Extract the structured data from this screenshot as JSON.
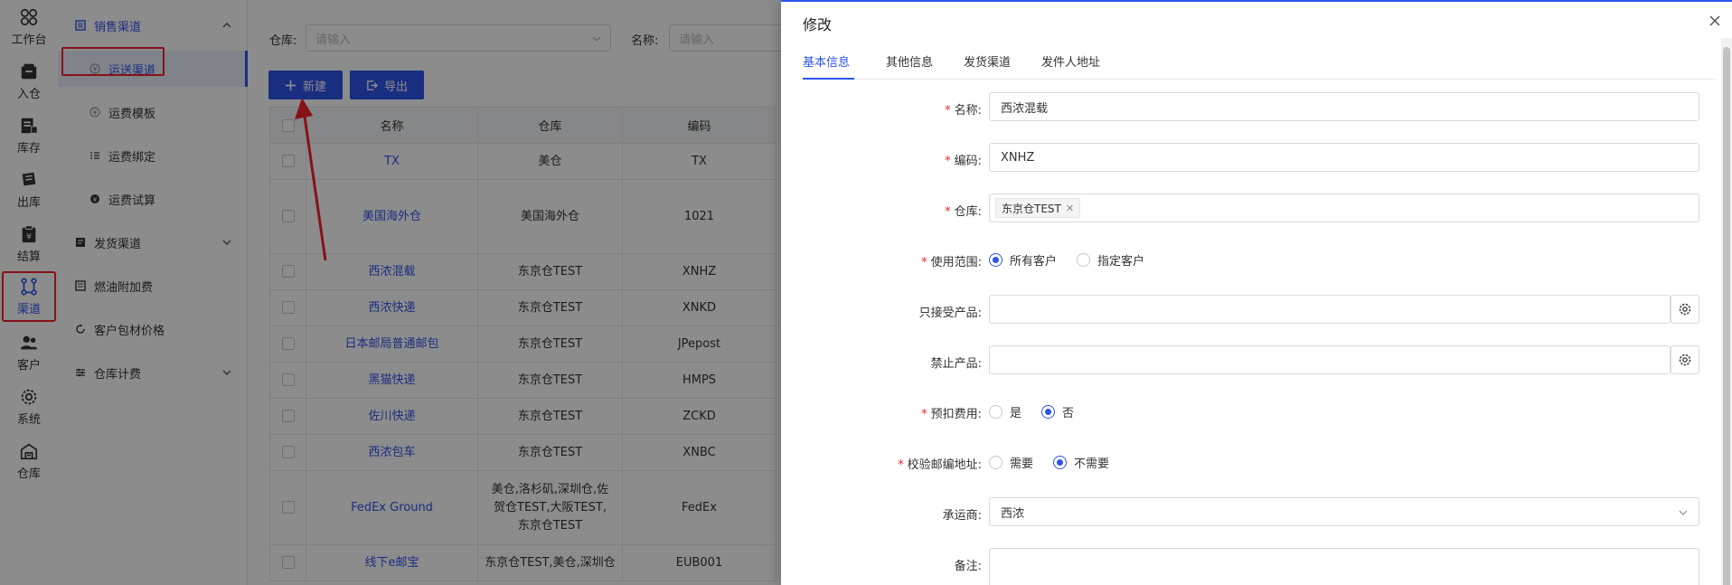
{
  "rail": [
    {
      "label": "工作台",
      "icon": "grid-icon"
    },
    {
      "label": "入仓",
      "icon": "inbound-icon"
    },
    {
      "label": "库存",
      "icon": "inventory-icon"
    },
    {
      "label": "出库",
      "icon": "outbound-icon"
    },
    {
      "label": "结算",
      "icon": "settlement-icon"
    },
    {
      "label": "渠道",
      "icon": "channel-icon",
      "active": true
    },
    {
      "label": "客户",
      "icon": "customer-icon"
    },
    {
      "label": "系统",
      "icon": "settings-icon"
    },
    {
      "label": "仓库",
      "icon": "warehouse-icon"
    }
  ],
  "submenu": {
    "sales_channel": "销售渠道",
    "shipping_channel": "运送渠道",
    "freight_template": "运费模板",
    "freight_binding": "运费绑定",
    "freight_trial": "运费试算",
    "delivery_channel": "发货渠道",
    "fuel_surcharge": "燃油附加费",
    "customer_material_price": "客户包材价格",
    "warehouse_billing": "仓库计费"
  },
  "filters": {
    "warehouse_label": "仓库:",
    "warehouse_placeholder": "请输入",
    "name_label": "名称:",
    "name_placeholder": "请输入"
  },
  "toolbar": {
    "new_label": "新建",
    "export_label": "导出"
  },
  "table": {
    "headers": [
      "名称",
      "仓库",
      "编码"
    ],
    "rows": [
      {
        "name": "TX",
        "warehouse": "美仓",
        "code": "TX"
      },
      {
        "name": "美国海外仓",
        "warehouse": "美国海外仓",
        "code": "1021"
      },
      {
        "name": "西浓混载",
        "warehouse": "东京仓TEST",
        "code": "XNHZ"
      },
      {
        "name": "西浓快递",
        "warehouse": "东京仓TEST",
        "code": "XNKD"
      },
      {
        "name": "日本邮局普通邮包",
        "warehouse": "东京仓TEST",
        "code": "JPepost"
      },
      {
        "name": "黑猫快递",
        "warehouse": "东京仓TEST",
        "code": "HMPS"
      },
      {
        "name": "佐川快递",
        "warehouse": "东京仓TEST",
        "code": "ZCKD"
      },
      {
        "name": "西浓包车",
        "warehouse": "东京仓TEST",
        "code": "XNBC"
      },
      {
        "name": "FedEx Ground",
        "warehouse": "美仓,洛杉矶,深圳仓,佐贺仓TEST,大阪TEST,东京仓TEST",
        "code": "FedEx"
      },
      {
        "name": "线下e邮宝",
        "warehouse": "东京仓TEST,美仓,深圳仓",
        "code": "EUB001"
      }
    ]
  },
  "drawer": {
    "title": "修改",
    "tabs": [
      "基本信息",
      "其他信息",
      "发货渠道",
      "发件人地址"
    ],
    "fields": {
      "name_label": "名称:",
      "name_value": "西浓混载",
      "code_label": "编码:",
      "code_value": "XNHZ",
      "warehouse_label": "仓库:",
      "warehouse_tag": "东京仓TEST",
      "scope_label": "使用范围:",
      "scope_all": "所有客户",
      "scope_specified": "指定客户",
      "accept_label": "只接受产品:",
      "forbid_label": "禁止产品:",
      "prededuct_label": "预扣费用:",
      "prededuct_yes": "是",
      "prededuct_no": "否",
      "zip_label": "校验邮编地址:",
      "zip_need": "需要",
      "zip_noneed": "不需要",
      "carrier_label": "承运商:",
      "carrier_value": "西浓",
      "remark_label": "备注:"
    }
  },
  "colors": {
    "accent": "#2f54eb",
    "highlight": "#f5222d"
  }
}
